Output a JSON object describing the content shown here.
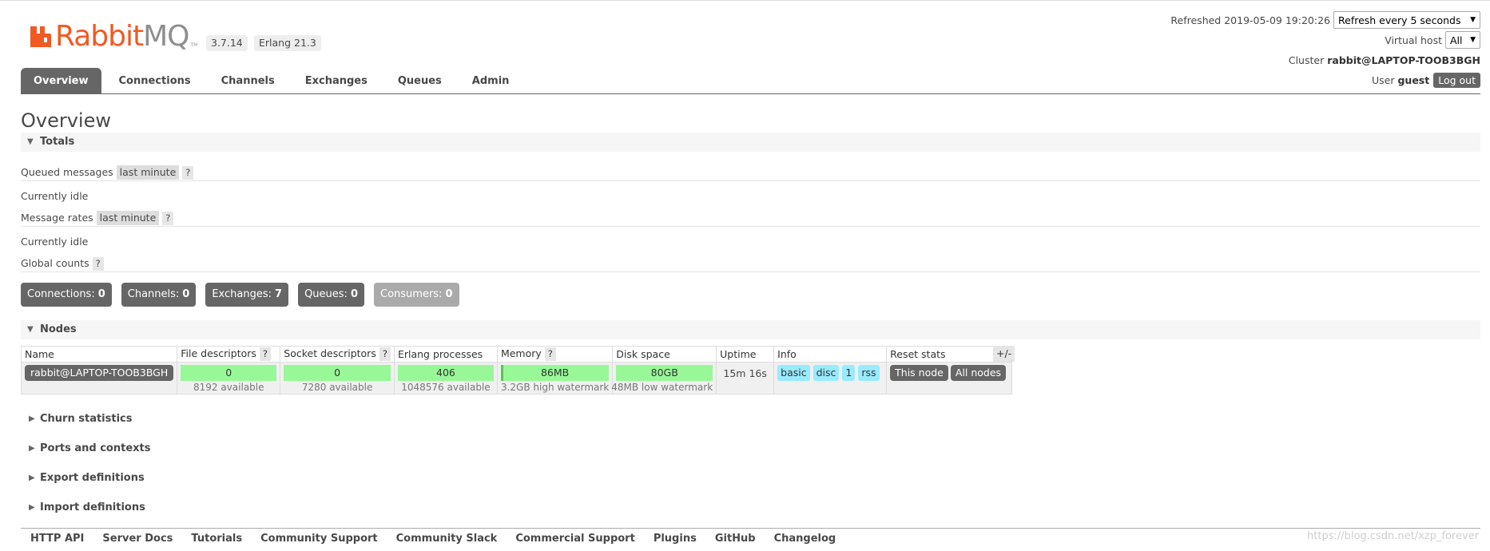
{
  "brand": {
    "name_part1": "Rabbit",
    "name_part2": "MQ",
    "tm": "TM",
    "color": "#f15a22"
  },
  "versions": {
    "rabbitmq": "3.7.14",
    "erlang": "Erlang 21.3"
  },
  "status": {
    "refreshed_label": "Refreshed",
    "refreshed_time": "2019-05-09 19:20:26",
    "refresh_select": "Refresh every 5 seconds",
    "vhost_label": "Virtual host",
    "vhost_select": "All",
    "cluster_label": "Cluster",
    "cluster_name": "rabbit@LAPTOP-TOOB3BGH",
    "user_label": "User",
    "user_name": "guest",
    "logout_label": "Log out"
  },
  "tabs": [
    {
      "label": "Overview",
      "active": true
    },
    {
      "label": "Connections"
    },
    {
      "label": "Channels"
    },
    {
      "label": "Exchanges"
    },
    {
      "label": "Queues"
    },
    {
      "label": "Admin"
    }
  ],
  "page_title": "Overview",
  "totals": {
    "heading": "Totals",
    "queued_messages_label": "Queued messages",
    "queued_range": "last minute",
    "help": "?",
    "idle_1": "Currently idle",
    "message_rates_label": "Message rates",
    "rates_range": "last minute",
    "idle_2": "Currently idle",
    "global_counts_label": "Global counts"
  },
  "counts": [
    {
      "label": "Connections:",
      "value": "0"
    },
    {
      "label": "Channels:",
      "value": "0"
    },
    {
      "label": "Exchanges:",
      "value": "7"
    },
    {
      "label": "Queues:",
      "value": "0"
    },
    {
      "label": "Consumers:",
      "value": "0"
    }
  ],
  "nodes": {
    "heading": "Nodes",
    "columns": {
      "name": "Name",
      "file_descriptors": "File descriptors",
      "socket_descriptors": "Socket descriptors",
      "erlang_processes": "Erlang processes",
      "memory": "Memory",
      "disk_space": "Disk space",
      "uptime": "Uptime",
      "info": "Info",
      "reset_stats": "Reset stats"
    },
    "plus_minus": "+/-",
    "row": {
      "name": "rabbit@LAPTOP-TOOB3BGH",
      "file_descriptors": "0",
      "file_available": "8192 available",
      "socket_descriptors": "0",
      "socket_available": "7280 available",
      "erlang_processes": "406",
      "erlang_available": "1048576 available",
      "memory": "86MB",
      "memory_watermark": "3.2GB high watermark",
      "disk_space": "80GB",
      "disk_watermark": "48MB low watermark",
      "uptime": "15m 16s",
      "info_badges": [
        "basic",
        "disc",
        "1",
        "rss"
      ],
      "reset_this": "This node",
      "reset_all": "All nodes"
    }
  },
  "collapsed_sections": [
    "Churn statistics",
    "Ports and contexts",
    "Export definitions",
    "Import definitions"
  ],
  "footer": [
    "HTTP API",
    "Server Docs",
    "Tutorials",
    "Community Support",
    "Community Slack",
    "Commercial Support",
    "Plugins",
    "GitHub",
    "Changelog"
  ],
  "watermark": "https://blog.csdn.net/xzp_forever"
}
